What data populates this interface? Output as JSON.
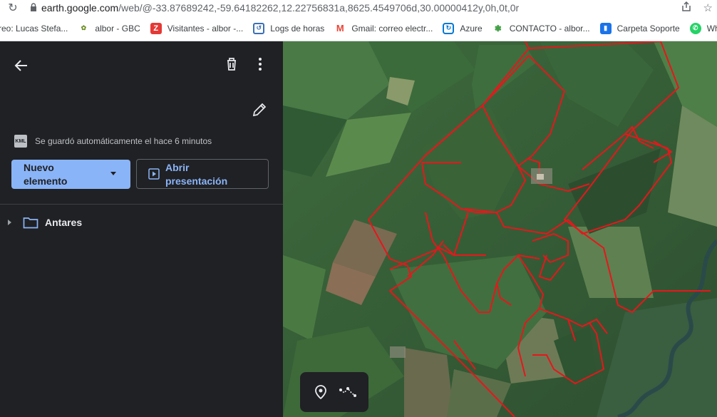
{
  "browser": {
    "url_host": "earth.google.com",
    "url_path": "/web/@-33.87689242,-59.64182262,12.22756831a,8625.4549706d,30.00000412y,0h,0t,0r"
  },
  "bookmarks": [
    {
      "label": "reo: Lucas Stefa...",
      "icon": "mail-icon",
      "color": "#5f6368"
    },
    {
      "label": "albor - GBC",
      "icon": "albor-logo-icon",
      "color": "#6b8e23"
    },
    {
      "label": "Visitantes - albor -...",
      "icon": "z-icon",
      "color": "#e53935"
    },
    {
      "label": "Logs de horas",
      "icon": "logs-icon",
      "color": "#3b6fb6"
    },
    {
      "label": "Gmail: correo electr...",
      "icon": "gmail-icon",
      "color": "#ea4335"
    },
    {
      "label": "Azure",
      "icon": "azure-icon",
      "color": "#0078d4"
    },
    {
      "label": "CONTACTO - albor...",
      "icon": "plant-icon",
      "color": "#43a047"
    },
    {
      "label": "Carpeta Soporte",
      "icon": "folder-chart-icon",
      "color": "#1a73e8"
    },
    {
      "label": "Wh",
      "icon": "whatsapp-icon",
      "color": "#25d366"
    }
  ],
  "panel": {
    "autosave_text": "Se guardó automáticamente el hace 6 minutos",
    "kml_badge": "KML",
    "new_item_label_1": "Nuevo",
    "new_item_label_2": "elemento",
    "present_label_1": "Abrir",
    "present_label_2": "presentación",
    "folder_name": "Antares"
  },
  "colors": {
    "accent_blue": "#8ab4f8",
    "panel_bg": "#202124",
    "field_outline": "#e8161b"
  }
}
